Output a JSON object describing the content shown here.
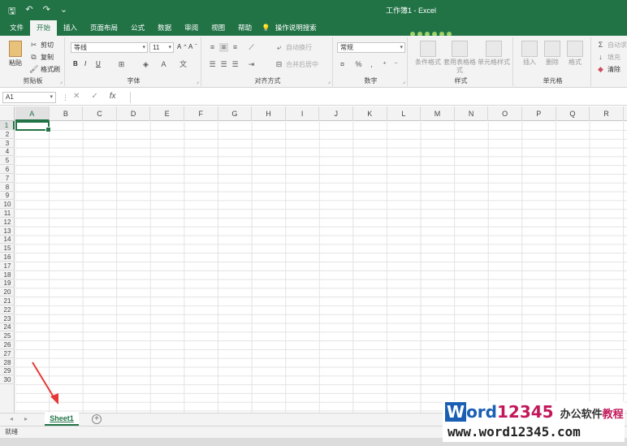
{
  "window": {
    "title": "工作簿1 - Excel"
  },
  "quick_access": {
    "save": "🖫",
    "undo": "↶",
    "redo": "↷",
    "more": "⌄"
  },
  "tabs": [
    {
      "label": "文件"
    },
    {
      "label": "开始"
    },
    {
      "label": "插入"
    },
    {
      "label": "页面布局"
    },
    {
      "label": "公式"
    },
    {
      "label": "数据"
    },
    {
      "label": "审阅"
    },
    {
      "label": "视图"
    },
    {
      "label": "帮助"
    }
  ],
  "tell_me": "操作说明搜索",
  "ribbon": {
    "clipboard": {
      "label": "剪贴板",
      "paste": "粘贴",
      "cut": "剪切",
      "copy": "复制",
      "format_painter": "格式刷"
    },
    "font": {
      "label": "字体",
      "name": "等线",
      "size": "11",
      "bold": "B",
      "italic": "I",
      "underline": "U"
    },
    "alignment": {
      "label": "对齐方式",
      "wrap": "自动换行",
      "merge": "合并后居中"
    },
    "number": {
      "label": "数字",
      "format": "常规"
    },
    "styles": {
      "label": "样式",
      "conditional": "条件格式",
      "table": "套用表格格式",
      "cell": "单元格样式"
    },
    "cells": {
      "label": "单元格",
      "insert": "插入",
      "delete": "删除",
      "format": "格式"
    },
    "editing": {
      "autosum": "自动求和",
      "fill": "填充",
      "clear": "清除"
    }
  },
  "formula_bar": {
    "name_box": "A1",
    "fx": "fx"
  },
  "columns": [
    "A",
    "B",
    "C",
    "D",
    "E",
    "F",
    "G",
    "H",
    "I",
    "J",
    "K",
    "L",
    "M",
    "N",
    "O",
    "P",
    "Q",
    "R"
  ],
  "rows": [
    "1",
    "2",
    "3",
    "4",
    "5",
    "6",
    "7",
    "8",
    "9",
    "10",
    "11",
    "12",
    "13",
    "14",
    "15",
    "16",
    "17",
    "18",
    "19",
    "20",
    "21",
    "22",
    "23",
    "24",
    "25",
    "26",
    "27",
    "28",
    "29",
    "30"
  ],
  "sheets": [
    {
      "name": "Sheet1"
    }
  ],
  "add_sheet": "+",
  "status": "就绪",
  "watermark": {
    "w": "W",
    "ord": "ord",
    "num": "12345",
    "cn1": "办公软件",
    "cn2": "教程",
    "url": "www.word12345.com"
  },
  "colors": {
    "accent": "#217346",
    "annotation_arrow": "#e53935"
  }
}
